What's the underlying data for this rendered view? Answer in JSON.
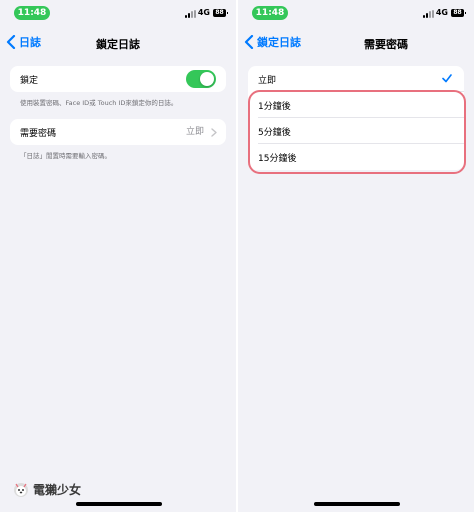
{
  "left": {
    "status": {
      "time": "11:48",
      "network": "4G",
      "battery": "88"
    },
    "nav": {
      "back_label": "日誌",
      "title": "鎖定日誌"
    },
    "lock_row": {
      "label": "鎖定",
      "toggle_on": true
    },
    "lock_footnote": "使用裝置密碼、Face ID或 Touch ID來鎖定你的日誌。",
    "passcode_row": {
      "label": "需要密碼",
      "value": "立即"
    },
    "passcode_footnote": "「日誌」閒置時需要輸入密碼。"
  },
  "right": {
    "status": {
      "time": "11:48",
      "network": "4G",
      "battery": "88"
    },
    "nav": {
      "back_label": "鎖定日誌",
      "title": "需要密碼"
    },
    "options": [
      {
        "label": "立即",
        "selected": true
      },
      {
        "label": "1分鐘後",
        "selected": false
      },
      {
        "label": "5分鐘後",
        "selected": false
      },
      {
        "label": "15分鐘後",
        "selected": false
      }
    ],
    "highlight_color": "#e8707e"
  },
  "watermark": {
    "text": "電獺少女"
  },
  "colors": {
    "accent": "#007aff",
    "toggle_on": "#34c759",
    "background": "#f2f2f7"
  }
}
